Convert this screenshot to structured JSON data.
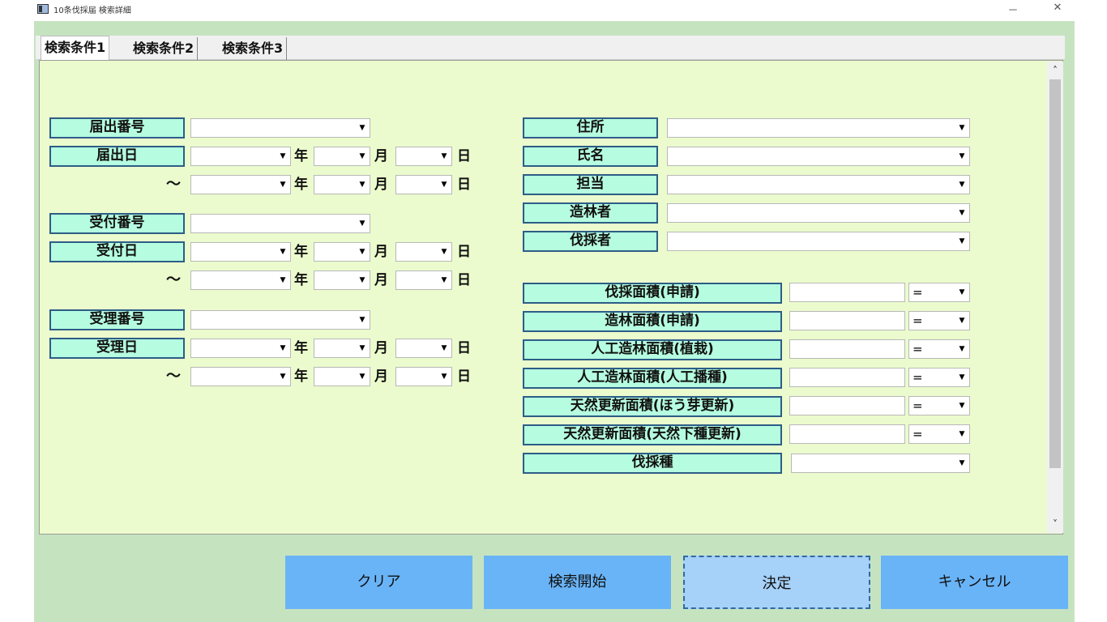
{
  "window": {
    "title": "10条伐採届 検索詳細",
    "minimize": "－",
    "close": "✕"
  },
  "tabs": [
    "検索条件1",
    "検索条件2",
    "検索条件3"
  ],
  "left": {
    "todokede_no": "届出番号",
    "todokede_date": "届出日",
    "uketsuke_no": "受付番号",
    "uketsuke_date": "受付日",
    "juri_no": "受理番号",
    "juri_date": "受理日",
    "tilde": "～",
    "year_unit": "年",
    "month_unit": "月",
    "day_unit": "日"
  },
  "right": {
    "address": "住所",
    "name": "氏名",
    "tanto": "担当",
    "zorinsha": "造林者",
    "bassaisha": "伐採者",
    "area_labels": [
      "伐採面積(申請)",
      "造林面積(申請)",
      "人工造林面積(植栽)",
      "人工造林面積(人工播種)",
      "天然更新面積(ほう芽更新)",
      "天然更新面積(天然下種更新)"
    ],
    "compare_value": "=",
    "bassai_shu": "伐採種"
  },
  "buttons": {
    "clear": "クリア",
    "search": "検索開始",
    "ok": "決定",
    "cancel": "キャンセル"
  }
}
